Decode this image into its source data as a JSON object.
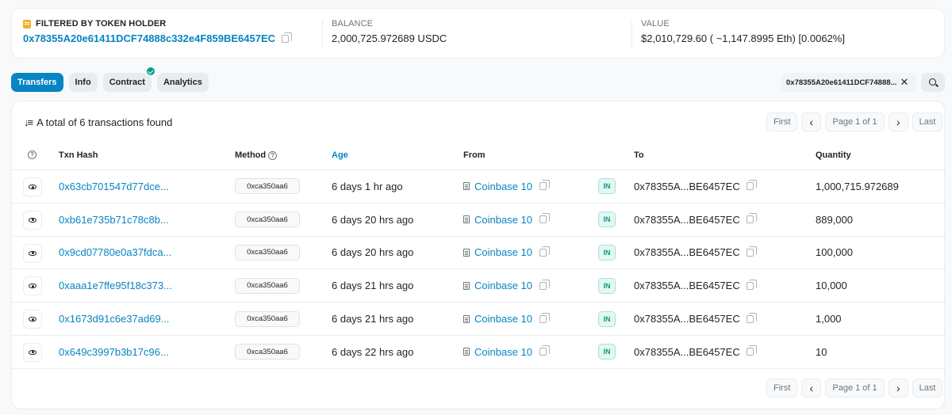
{
  "holder": {
    "label": "FILTERED BY TOKEN HOLDER",
    "address": "0x78355A20e61411DCF74888c332e4F859BE6457EC",
    "balance_label": "BALANCE",
    "balance": "2,000,725.972689 USDC",
    "value_label": "VALUE",
    "value": "$2,010,729.60 ( ~1,147.8995 Eth) [0.0062%]"
  },
  "tabs": [
    {
      "label": "Transfers",
      "active": true
    },
    {
      "label": "Info"
    },
    {
      "label": "Contract",
      "verified": true
    },
    {
      "label": "Analytics"
    }
  ],
  "filter": {
    "text": "0x78355A20e61411DCF74888..."
  },
  "summary": "A total of 6 transactions found",
  "pagination": {
    "first": "First",
    "page": "Page 1 of 1",
    "last": "Last"
  },
  "columns": {
    "txn_hash": "Txn Hash",
    "method": "Method",
    "age": "Age",
    "from": "From",
    "to": "To",
    "quantity": "Quantity"
  },
  "rows": [
    {
      "hash": "0x63cb701547d77dce...",
      "method": "0xca350aa6",
      "age": "6 days 1 hr ago",
      "from": "Coinbase 10",
      "dir": "IN",
      "to": "0x78355A...BE6457EC",
      "qty": "1,000,715.972689"
    },
    {
      "hash": "0xb61e735b71c78c8b...",
      "method": "0xca350aa6",
      "age": "6 days 20 hrs ago",
      "from": "Coinbase 10",
      "dir": "IN",
      "to": "0x78355A...BE6457EC",
      "qty": "889,000"
    },
    {
      "hash": "0x9cd07780e0a37fdca...",
      "method": "0xca350aa6",
      "age": "6 days 20 hrs ago",
      "from": "Coinbase 10",
      "dir": "IN",
      "to": "0x78355A...BE6457EC",
      "qty": "100,000"
    },
    {
      "hash": "0xaaa1e7ffe95f18c373...",
      "method": "0xca350aa6",
      "age": "6 days 21 hrs ago",
      "from": "Coinbase 10",
      "dir": "IN",
      "to": "0x78355A...BE6457EC",
      "qty": "10,000"
    },
    {
      "hash": "0x1673d91c6e37ad69...",
      "method": "0xca350aa6",
      "age": "6 days 21 hrs ago",
      "from": "Coinbase 10",
      "dir": "IN",
      "to": "0x78355A...BE6457EC",
      "qty": "1,000"
    },
    {
      "hash": "0x649c3997b3b17c96...",
      "method": "0xca350aa6",
      "age": "6 days 22 hrs ago",
      "from": "Coinbase 10",
      "dir": "IN",
      "to": "0x78355A...BE6457EC",
      "qty": "10"
    }
  ],
  "icons": {
    "holder": "token-icon",
    "copy": "copy-icon",
    "verified": "check-icon",
    "close": "close-icon",
    "search": "search-icon",
    "sort": "sort-icon",
    "help": "help-icon",
    "view": "eye-icon",
    "contract": "document-icon"
  },
  "colors": {
    "accent": "#0784c3",
    "success": "#00a186",
    "token": "#f0b429"
  }
}
